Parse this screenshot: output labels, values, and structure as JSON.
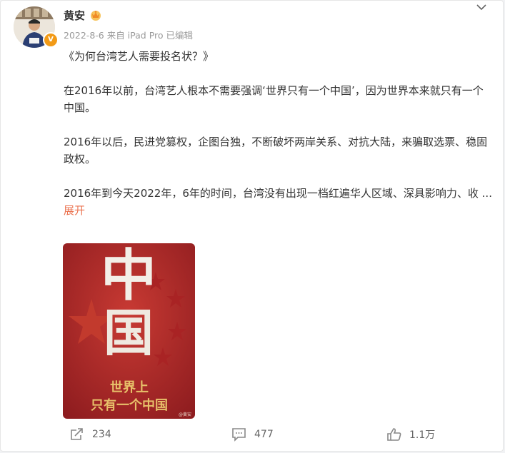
{
  "post": {
    "author": "黄安",
    "meta": "2022-8-6  来自 iPad Pro 已编辑",
    "paragraphs": [
      "《为何台湾艺人需要投名状？》",
      "在2016年以前，台湾艺人根本不需要强调‘世界只有一个中国’，因为世界本来就只有一个中国。",
      "2016年以后，民进党篡权，企图台独，不断破坏两岸关系、对抗大陆，来骗取选票、稳固政权。",
      "2016年到今天2022年，6年的时间，台湾没有出现一档红遍华人区域、深具影响力、收 ..."
    ],
    "expand_label": "展开",
    "verified_badge": "V"
  },
  "poster": {
    "big_char_1": "中",
    "big_char_2": "国",
    "line1": "世界上",
    "line2": "只有一个中国",
    "watermark": "@黄安"
  },
  "actions": {
    "repost_count": "234",
    "comment_count": "477",
    "like_count": "1.1万"
  },
  "colors": {
    "accent": "#eb7350",
    "poster_red": "#b8292b",
    "gold": "#e7c06a"
  }
}
